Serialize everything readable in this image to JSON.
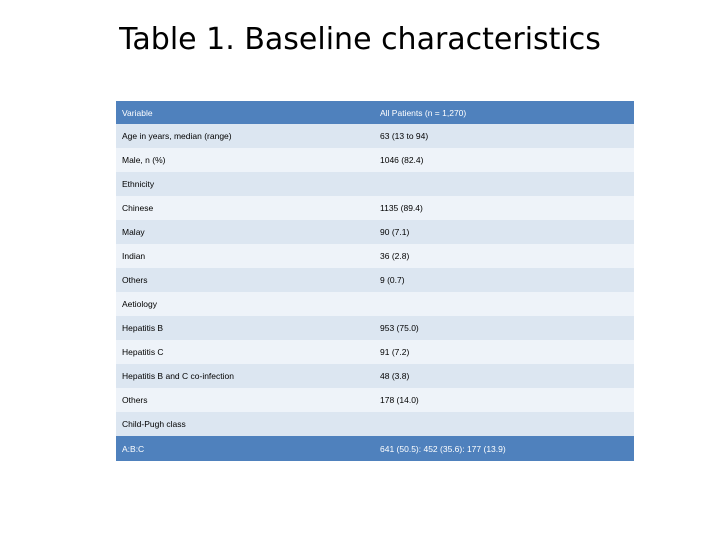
{
  "slide": {
    "title": "Table 1. Baseline characteristics"
  },
  "table": {
    "columns": [
      "Variable",
      "All Patients (n = 1,270)"
    ],
    "rows": [
      {
        "label": "Age in years, median (range)",
        "value": "63 (13 to 94)"
      },
      {
        "label": "Male, n (%)",
        "value": "1046 (82.4)"
      },
      {
        "label": "Ethnicity",
        "value": ""
      },
      {
        "label": "Chinese",
        "value": "1135 (89.4)"
      },
      {
        "label": "Malay",
        "value": "90 (7.1)"
      },
      {
        "label": "Indian",
        "value": "36 (2.8)"
      },
      {
        "label": "Others",
        "value": "9 (0.7)"
      },
      {
        "label": "Aetiology",
        "value": ""
      },
      {
        "label": "Hepatitis B",
        "value": "953 (75.0)"
      },
      {
        "label": "Hepatitis C",
        "value": "91 (7.2)"
      },
      {
        "label": "Hepatitis B and C co-infection",
        "value": "48 (3.8)"
      },
      {
        "label": "Others",
        "value": "178 (14.0)"
      },
      {
        "label": "Child-Pugh class",
        "value": ""
      },
      {
        "label": "A:B:C",
        "value": "641 (50.5): 452 (35.6): 177 (13.9)"
      }
    ]
  },
  "colors": {
    "header_fill": "#4f81bd",
    "band_a": "#dce6f1",
    "band_b": "#eef3f9",
    "text": "#000000"
  }
}
